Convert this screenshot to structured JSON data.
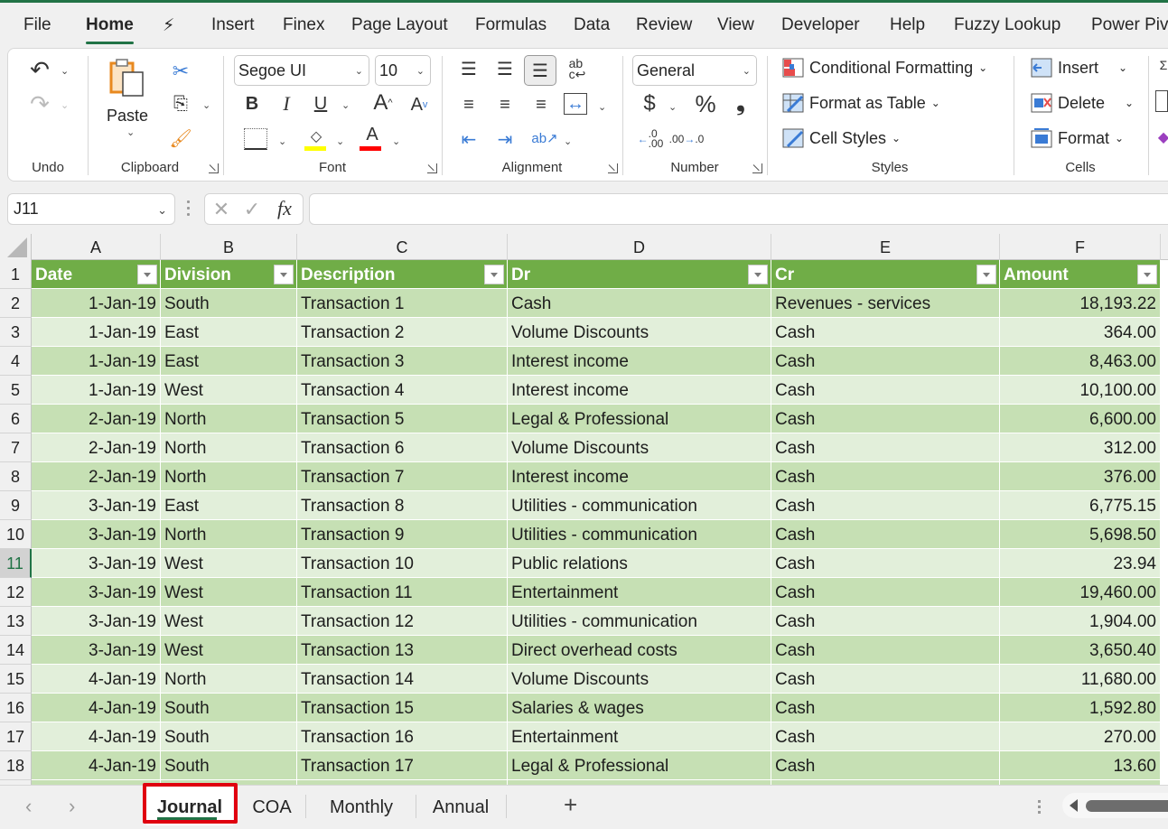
{
  "menu": {
    "tabs": [
      "File",
      "Home",
      "⚡",
      "Insert",
      "Finex",
      "Page Layout",
      "Formulas",
      "Data",
      "Review",
      "View",
      "Developer",
      "Help",
      "Fuzzy Lookup",
      "Power Piv"
    ],
    "active": "Home"
  },
  "ribbon": {
    "undo": {
      "label": "Undo"
    },
    "clipboard": {
      "label": "Clipboard",
      "paste": "Paste"
    },
    "font": {
      "label": "Font",
      "family": "Segoe UI",
      "size": "10",
      "bold": "B",
      "italic": "I",
      "underline": "U",
      "grow": "A",
      "shrink": "A",
      "fill_color": "#ffff00",
      "font_color": "#ff0000"
    },
    "alignment": {
      "label": "Alignment"
    },
    "number": {
      "label": "Number",
      "format": "General",
      "currency": "$",
      "percent": "%",
      "comma": "❟"
    },
    "styles": {
      "label": "Styles",
      "conditional": "Conditional Formatting",
      "format_table": "Format as Table",
      "cell_styles": "Cell Styles"
    },
    "cells": {
      "label": "Cells",
      "insert": "Insert",
      "delete": "Delete",
      "format": "Format"
    }
  },
  "formula_bar": {
    "name_box": "J11",
    "fx": "fx",
    "value": ""
  },
  "sheet": {
    "columns": [
      "A",
      "B",
      "C",
      "D",
      "E",
      "F"
    ],
    "headers": [
      "Date",
      "Division",
      "Description",
      "Dr",
      "Cr",
      "Amount"
    ],
    "selected_row": 11,
    "rows": [
      [
        "1-Jan-19",
        "South",
        "Transaction 1",
        "Cash",
        "Revenues - services",
        "18,193.22"
      ],
      [
        "1-Jan-19",
        "East",
        "Transaction 2",
        "Volume Discounts",
        "Cash",
        "364.00"
      ],
      [
        "1-Jan-19",
        "East",
        "Transaction 3",
        "Interest income",
        "Cash",
        "8,463.00"
      ],
      [
        "1-Jan-19",
        "West",
        "Transaction 4",
        "Interest income",
        "Cash",
        "10,100.00"
      ],
      [
        "2-Jan-19",
        "North",
        "Transaction 5",
        "Legal & Professional",
        "Cash",
        "6,600.00"
      ],
      [
        "2-Jan-19",
        "North",
        "Transaction 6",
        "Volume Discounts",
        "Cash",
        "312.00"
      ],
      [
        "2-Jan-19",
        "North",
        "Transaction 7",
        "Interest income",
        "Cash",
        "376.00"
      ],
      [
        "3-Jan-19",
        "East",
        "Transaction 8",
        "Utilities - communication",
        "Cash",
        "6,775.15"
      ],
      [
        "3-Jan-19",
        "North",
        "Transaction 9",
        "Utilities - communication",
        "Cash",
        "5,698.50"
      ],
      [
        "3-Jan-19",
        "West",
        "Transaction 10",
        "Public relations",
        "Cash",
        "23.94"
      ],
      [
        "3-Jan-19",
        "West",
        "Transaction 11",
        "Entertainment",
        "Cash",
        "19,460.00"
      ],
      [
        "3-Jan-19",
        "West",
        "Transaction 12",
        "Utilities - communication",
        "Cash",
        "1,904.00"
      ],
      [
        "3-Jan-19",
        "West",
        "Transaction 13",
        "Direct overhead costs",
        "Cash",
        "3,650.40"
      ],
      [
        "4-Jan-19",
        "North",
        "Transaction 14",
        "Volume Discounts",
        "Cash",
        "11,680.00"
      ],
      [
        "4-Jan-19",
        "South",
        "Transaction 15",
        "Salaries & wages",
        "Cash",
        "1,592.80"
      ],
      [
        "4-Jan-19",
        "South",
        "Transaction 16",
        "Entertainment",
        "Cash",
        "270.00"
      ],
      [
        "4-Jan-19",
        "South",
        "Transaction 17",
        "Legal & Professional",
        "Cash",
        "13.60"
      ]
    ]
  },
  "sheet_tabs": {
    "tabs": [
      "Journal",
      "COA",
      "Monthly",
      "Annual"
    ],
    "active": "Journal",
    "add": "+"
  },
  "colors": {
    "accent": "#217346",
    "table_header": "#70ad47",
    "band_dark": "#c6e0b4",
    "band_light": "#e2efda",
    "highlight": "#e0000f"
  }
}
